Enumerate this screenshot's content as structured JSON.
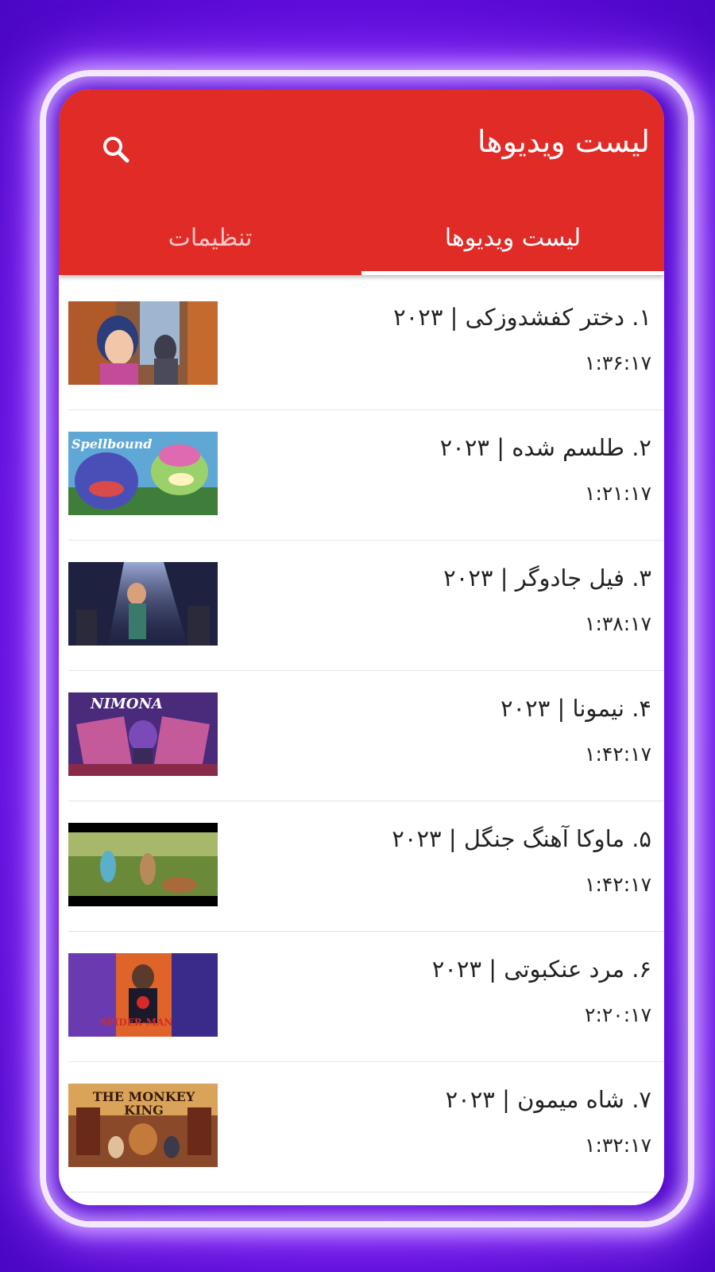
{
  "app": {
    "title": "لیست ویدیوها",
    "search_icon": "search-icon"
  },
  "tabs": [
    {
      "label": "لیست ویدیوها",
      "active": true
    },
    {
      "label": "تنظیمات",
      "active": false
    }
  ],
  "videos": [
    {
      "title": "۱. دختر کفشدوزکی | ۲۰۲۳",
      "duration": "۱:۳۶:۱۷"
    },
    {
      "title": "۲. طلسم شده | ۲۰۲۳",
      "duration": "۱:۲۱:۱۷",
      "thumb_text": "Spellbound"
    },
    {
      "title": "۳. فیل جادوگر | ۲۰۲۳",
      "duration": "۱:۳۸:۱۷"
    },
    {
      "title": "۴. نیمونا | ۲۰۲۳",
      "duration": "۱:۴۲:۱۷",
      "thumb_text": "NIMONA"
    },
    {
      "title": "۵. ماوکا آهنگ جنگل | ۲۰۲۳",
      "duration": "۱:۴۲:۱۷"
    },
    {
      "title": "۶. مرد عنکبوتی | ۲۰۲۳",
      "duration": "۲:۲۰:۱۷",
      "thumb_text": "SPIDER-MAN"
    },
    {
      "title": "۷. شاه میمون | ۲۰۲۳",
      "duration": "۱:۳۲:۱۷",
      "thumb_text": "THE MONKEY KING"
    }
  ],
  "colors": {
    "appbar": "#e02b27",
    "background": "#6a10e6"
  }
}
